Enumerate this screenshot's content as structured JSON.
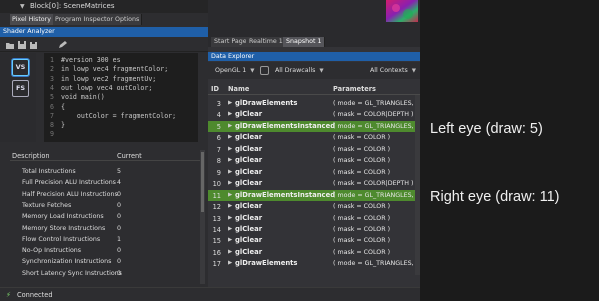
{
  "tree_header": {
    "text": "Block[0]: SceneMatrices"
  },
  "left_tabs": [
    "Pixel History",
    "Program Inspector",
    "Options"
  ],
  "shader_panel": {
    "title": "Shader Analyzer",
    "stages": [
      "VS",
      "FS"
    ],
    "code_lines": [
      {
        "n": "1",
        "t": "#version 300 es"
      },
      {
        "n": "2",
        "t": "in lowp vec4 fragmentColor;"
      },
      {
        "n": "3",
        "t": "in lowp vec2 fragmentUv;"
      },
      {
        "n": "4",
        "t": "out lowp vec4 outColor;"
      },
      {
        "n": "5",
        "t": "void main()"
      },
      {
        "n": "6",
        "t": "{"
      },
      {
        "n": "7",
        "t": "    outColor = fragmentColor;"
      },
      {
        "n": "8",
        "t": "}"
      },
      {
        "n": "9",
        "t": ""
      }
    ]
  },
  "stats_table": {
    "columns": [
      "Description",
      "Current"
    ],
    "rows": [
      {
        "desc": "Total Instructions",
        "value": "5"
      },
      {
        "desc": "Full Precision ALU Instructions",
        "value": "4"
      },
      {
        "desc": "Half Precision ALU Instructions",
        "value": "0"
      },
      {
        "desc": "Texture Fetches",
        "value": "0"
      },
      {
        "desc": "Memory Load Instructions",
        "value": "0"
      },
      {
        "desc": "Memory Store Instructions",
        "value": "0"
      },
      {
        "desc": "Flow Control Instructions",
        "value": "1"
      },
      {
        "desc": "No-Op Instructions",
        "value": "0"
      },
      {
        "desc": "Synchronization Instructions",
        "value": "0"
      },
      {
        "desc": "Short Latency Sync Instructions",
        "value": "0"
      }
    ]
  },
  "status": {
    "text": "Connected"
  },
  "right_tabs": [
    "Start Page",
    "Realtime 1",
    "Snapshot 1"
  ],
  "data_explorer": {
    "title": "Data Explorer",
    "api_combo": "OpenGL 1",
    "drawcall_combo": "All Drawcalls",
    "context_combo": "All Contexts",
    "columns": [
      "ID",
      "Name",
      "Parameters"
    ],
    "rows": [
      {
        "id": "3",
        "name": "glDrawElements",
        "param": "( mode = GL_TRIANGLES, co"
      },
      {
        "id": "4",
        "name": "glClear",
        "param": "( mask = COLOR|DEPTH )"
      },
      {
        "id": "5",
        "name": "glDrawElementsInstanced",
        "param": "( mode = GL_TRIANGLES, c"
      },
      {
        "id": "6",
        "name": "glClear",
        "param": "( mask = COLOR )"
      },
      {
        "id": "7",
        "name": "glClear",
        "param": "( mask = COLOR )"
      },
      {
        "id": "8",
        "name": "glClear",
        "param": "( mask = COLOR )"
      },
      {
        "id": "9",
        "name": "glClear",
        "param": "( mask = COLOR )"
      },
      {
        "id": "10",
        "name": "glClear",
        "param": "( mask = COLOR|DEPTH )"
      },
      {
        "id": "11",
        "name": "glDrawElementsInstanced",
        "param": "( mode = GL_TRIANGLES, c"
      },
      {
        "id": "12",
        "name": "glClear",
        "param": "( mask = COLOR )"
      },
      {
        "id": "13",
        "name": "glClear",
        "param": "( mask = COLOR )"
      },
      {
        "id": "14",
        "name": "glClear",
        "param": "( mask = COLOR )"
      },
      {
        "id": "15",
        "name": "glClear",
        "param": "( mask = COLOR )"
      },
      {
        "id": "16",
        "name": "glClear",
        "param": "( mask = COLOR )"
      },
      {
        "id": "17",
        "name": "glDrawElements",
        "param": "( mode = GL_TRIANGLES, co"
      }
    ],
    "highlighted_ids": [
      "5",
      "11"
    ]
  },
  "annotations": {
    "left_eye": "Left eye (draw: 5)",
    "right_eye": "Right eye (draw: 11)"
  },
  "colors": {
    "highlight_green": "#4e8a2e",
    "panel_header_blue": "#1f5fa8",
    "param_gold": "#d3c06e"
  }
}
